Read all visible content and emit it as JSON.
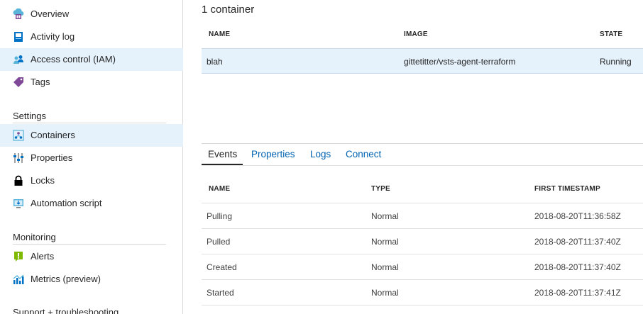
{
  "sidebar": {
    "items_top": [
      {
        "label": "Overview",
        "icon": "overview-icon"
      },
      {
        "label": "Activity log",
        "icon": "activity-log-icon"
      },
      {
        "label": "Access control (IAM)",
        "icon": "iam-icon"
      },
      {
        "label": "Tags",
        "icon": "tag-icon"
      }
    ],
    "settings_title": "Settings",
    "settings_items": [
      {
        "label": "Containers",
        "icon": "containers-icon"
      },
      {
        "label": "Properties",
        "icon": "properties-icon"
      },
      {
        "label": "Locks",
        "icon": "lock-icon"
      },
      {
        "label": "Automation script",
        "icon": "automation-script-icon"
      }
    ],
    "monitoring_title": "Monitoring",
    "monitoring_items": [
      {
        "label": "Alerts",
        "icon": "alert-icon"
      },
      {
        "label": "Metrics (preview)",
        "icon": "metrics-icon"
      }
    ],
    "support_title": "Support + troubleshooting"
  },
  "main": {
    "count_title": "1 container",
    "containers_table": {
      "headers": [
        "NAME",
        "IMAGE",
        "STATE"
      ],
      "rows": [
        {
          "name": "blah",
          "image": "gittetitter/vsts-agent-terraform",
          "state": "Running"
        }
      ]
    },
    "tabs": [
      "Events",
      "Properties",
      "Logs",
      "Connect"
    ],
    "active_tab": "Events",
    "events_table": {
      "headers": [
        "NAME",
        "TYPE",
        "FIRST TIMESTAMP"
      ],
      "rows": [
        {
          "name": "Pulling",
          "type": "Normal",
          "timestamp": "2018-08-20T11:36:58Z"
        },
        {
          "name": "Pulled",
          "type": "Normal",
          "timestamp": "2018-08-20T11:37:40Z"
        },
        {
          "name": "Created",
          "type": "Normal",
          "timestamp": "2018-08-20T11:37:40Z"
        },
        {
          "name": "Started",
          "type": "Normal",
          "timestamp": "2018-08-20T11:37:41Z"
        }
      ]
    }
  },
  "colors": {
    "selected_bg": "#e5f1fb",
    "link": "#0063b1",
    "icon_blue": "#0072c6",
    "icon_purple": "#804998",
    "icon_green": "#7fba00"
  }
}
